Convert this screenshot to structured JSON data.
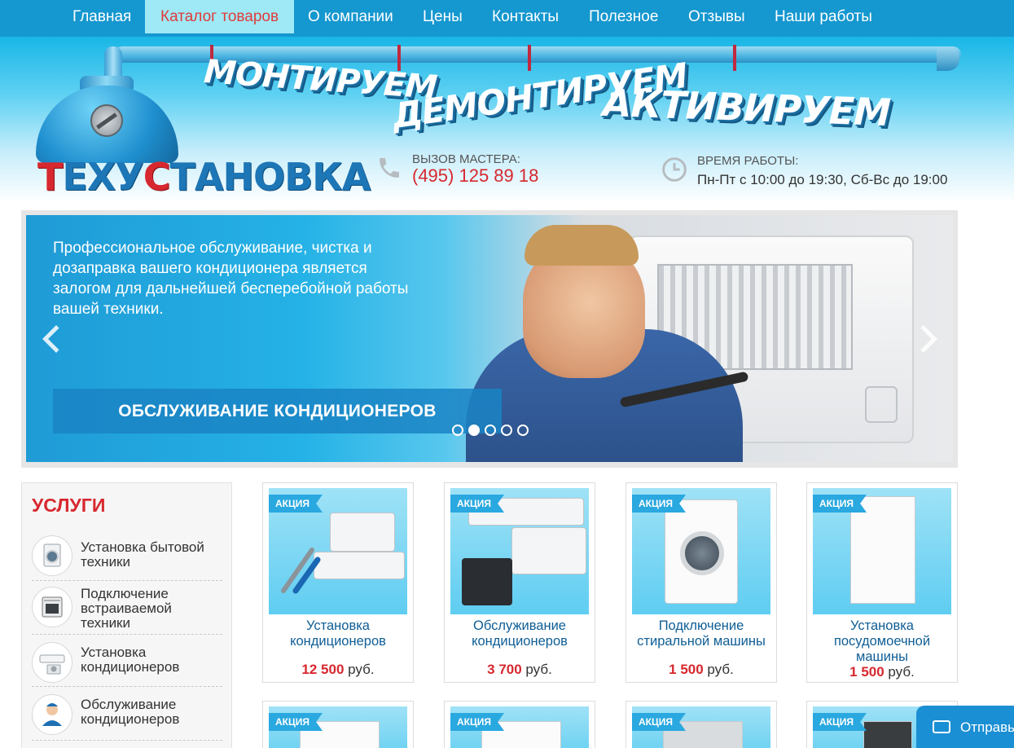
{
  "nav": {
    "items": [
      {
        "label": "Главная"
      },
      {
        "label": "Каталог товаров",
        "active": true
      },
      {
        "label": "О компании"
      },
      {
        "label": "Цены"
      },
      {
        "label": "Контакты"
      },
      {
        "label": "Полезное"
      },
      {
        "label": "Отзывы"
      },
      {
        "label": "Наши работы"
      }
    ]
  },
  "header": {
    "slogans": [
      "МОНТИРУЕМ",
      "ДЕМОНТИРУЕМ",
      "АКТИВИРУЕМ"
    ],
    "logo_text": "ТЕХУСТАНОВКА",
    "call_label": "ВЫЗОВ МАСТЕРА:",
    "phone": "(495) 125 89 18",
    "hours_label": "ВРЕМЯ РАБОТЫ:",
    "hours": "Пн-Пт с 10:00 до 19:30, Сб-Вс до 19:00"
  },
  "slider": {
    "text": "Профессиональное обслуживание, чистка и дозаправка вашего кондиционера является залогом для дальнейшей бесперебойной работы вашей техники.",
    "banner": "ОБСЛУЖИВАНИЕ КОНДИЦИОНЕРОВ",
    "dot_count": 5,
    "active_dot": 2
  },
  "sidebar": {
    "title": "УСЛУГИ",
    "items": [
      {
        "label": "Установка бытовой техники",
        "icon": "washing-machine-icon"
      },
      {
        "label": "Подключение встраиваемой техники",
        "icon": "oven-icon"
      },
      {
        "label": "Установка кондиционеров",
        "icon": "air-conditioner-icon"
      },
      {
        "label": "Обслуживание кондиционеров",
        "icon": "technician-icon"
      }
    ]
  },
  "products": [
    {
      "tag": "АКЦИЯ",
      "title": "Установка кондиционеров",
      "price": "12 500",
      "currency": "руб."
    },
    {
      "tag": "АКЦИЯ",
      "title": "Обслуживание кондиционеров",
      "price": "3 700",
      "currency": "руб."
    },
    {
      "tag": "АКЦИЯ",
      "title": "Подключение стиральной машины",
      "price": "1 500",
      "currency": "руб."
    },
    {
      "tag": "АКЦИЯ",
      "title": "Установка посудомоечной машины",
      "price": "1 500",
      "currency": "руб."
    }
  ],
  "products_row2": [
    {
      "tag": "АКЦИЯ"
    },
    {
      "tag": "АКЦИЯ"
    },
    {
      "tag": "АКЦИЯ"
    },
    {
      "tag": "АКЦИЯ"
    }
  ],
  "chat": {
    "label": "Отправь"
  },
  "colors": {
    "nav": "#1597cf",
    "accent_red": "#d7282f",
    "title_blue": "#0f5e96",
    "tag_blue": "#2aa8e0"
  }
}
